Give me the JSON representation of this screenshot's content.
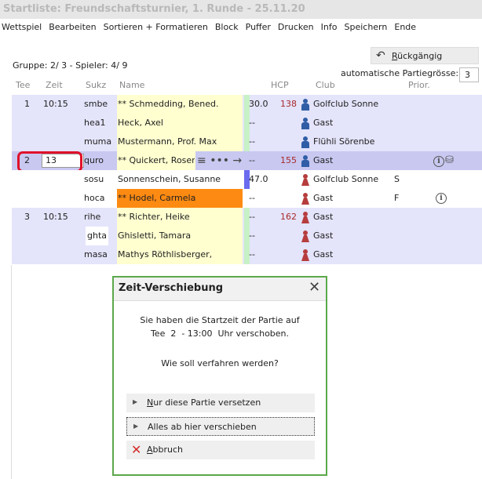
{
  "window": {
    "title": "Startliste: Freundschaftsturnier, 1. Runde - 25.11.20"
  },
  "menu": [
    "Wettspiel",
    "Bearbeiten",
    "Sortieren + Formatieren",
    "Block",
    "Puffer",
    "Drucken",
    "Info",
    "Speichern",
    "Ende"
  ],
  "toolbar": {
    "undo_label": "Rückgängig",
    "autosize_label": "automatische Partiegrösse:",
    "autosize_value": "3"
  },
  "group_info": "Gruppe:  2/  3 - Spieler:  4/  9",
  "columns": {
    "tee": "Tee",
    "zeit": "Zeit",
    "sukz": "Sukz",
    "name": "Name",
    "hcp": "HCP",
    "club": "Club",
    "prior": "Prior."
  },
  "rows": [
    {
      "tee": "1",
      "zeit": "10:15",
      "sukz": "smbe",
      "name": "** Schmedding, Bened.",
      "hcp": "30.0",
      "hcp2": "138",
      "club": "Golfclub Sonne",
      "prior": ""
    },
    {
      "tee": "",
      "zeit": "",
      "sukz": "hea1",
      "name": "Heck, Axel",
      "hcp": "--",
      "hcp2": "",
      "club": "Gast",
      "prior": ""
    },
    {
      "tee": "",
      "zeit": "",
      "sukz": "muma",
      "name": "Mustermann, Prof. Max",
      "hcp": "--",
      "hcp2": "",
      "club": "Flühli Sörenbe",
      "prior": ""
    },
    {
      "tee": "2",
      "zeit": "13",
      "sukz": "quro",
      "name": "** Quickert, Rosen",
      "hcp": "--",
      "hcp2": "155",
      "club": "Gast",
      "prior": ""
    },
    {
      "tee": "",
      "zeit": "",
      "sukz": "sosu",
      "name": "Sonnenschein, Susanne",
      "hcp": "47.0",
      "hcp2": "",
      "club": "Golfclub Sonne",
      "prior": "S"
    },
    {
      "tee": "",
      "zeit": "",
      "sukz": "hoca",
      "name": "** Hodel, Carmela",
      "hcp": "--",
      "hcp2": "",
      "club": "Gast",
      "prior": "F"
    },
    {
      "tee": "3",
      "zeit": "10:15",
      "sukz": "rihe",
      "name": "** Richter, Heike",
      "hcp": "--",
      "hcp2": "162",
      "club": "Gast",
      "prior": ""
    },
    {
      "tee": "",
      "zeit": "",
      "sukz": "ghta",
      "name": "Ghisletti, Tamara",
      "hcp": "--",
      "hcp2": "",
      "club": "Gast",
      "prior": ""
    },
    {
      "tee": "",
      "zeit": "",
      "sukz": "masa",
      "name": "Mathys Röthlisberger,",
      "hcp": "--",
      "hcp2": "",
      "club": "Gast",
      "prior": ""
    }
  ],
  "dialog": {
    "title": "Zeit-Verschiebung",
    "line1": "Sie haben die Startzeit der Partie auf",
    "line2": "Tee  2  - 13:00  Uhr verschoben.",
    "question": "Wie soll verfahren werden?",
    "opt1": "Nur diese Partie versetzen",
    "opt2": "Alles ab hier verschieben",
    "cancel": "Abbruch"
  },
  "colors": {
    "accent_border": "#5ba84a",
    "highlight_red": "#e0102a",
    "selected_row": "#c8c8f1"
  }
}
